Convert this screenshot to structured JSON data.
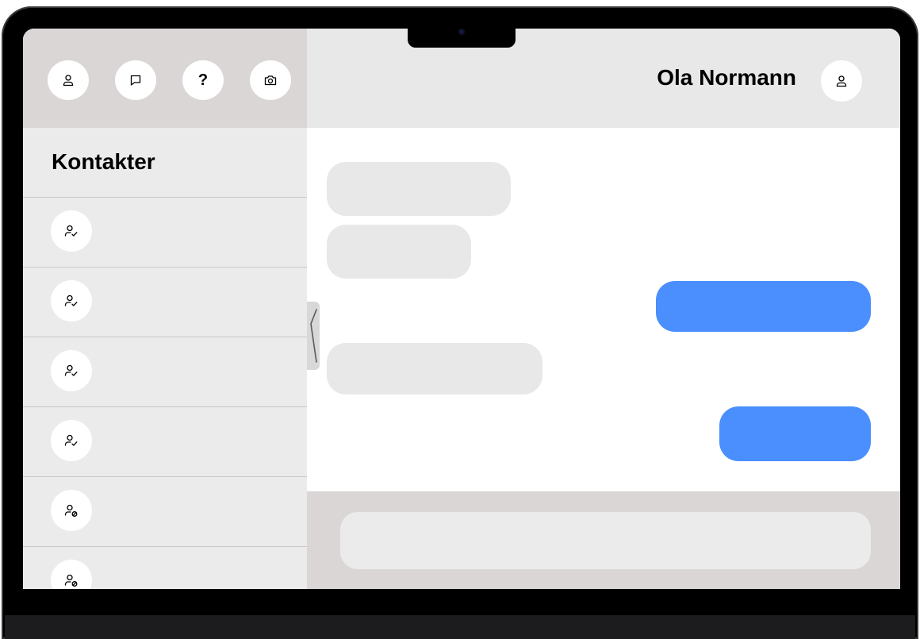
{
  "toolbar": {
    "buttons": [
      {
        "icon": "user-icon"
      },
      {
        "icon": "chat-icon"
      },
      {
        "icon": "help-icon",
        "glyph": "?"
      },
      {
        "icon": "camera-icon"
      }
    ]
  },
  "sidebar": {
    "title": "Kontakter",
    "contacts": [
      {
        "status": "verified",
        "icon": "user-check-icon"
      },
      {
        "status": "verified",
        "icon": "user-check-icon"
      },
      {
        "status": "verified",
        "icon": "user-check-icon"
      },
      {
        "status": "verified",
        "icon": "user-check-icon"
      },
      {
        "status": "blocked",
        "icon": "user-blocked-icon"
      },
      {
        "status": "blocked",
        "icon": "user-blocked-icon"
      }
    ]
  },
  "chat": {
    "contact_name": "Ola Normann",
    "header_icon": "user-icon",
    "messages": [
      {
        "direction": "incoming",
        "text": ""
      },
      {
        "direction": "incoming",
        "text": ""
      },
      {
        "direction": "outgoing",
        "text": ""
      },
      {
        "direction": "incoming",
        "text": ""
      },
      {
        "direction": "outgoing",
        "text": ""
      }
    ],
    "input": {
      "value": "",
      "placeholder": ""
    }
  },
  "colors": {
    "outgoing_bubble": "#4a8ffd",
    "incoming_bubble": "#e8e8e8",
    "toolbar_bg": "#dbd6d6",
    "sidebar_bg": "#ebebeb"
  }
}
